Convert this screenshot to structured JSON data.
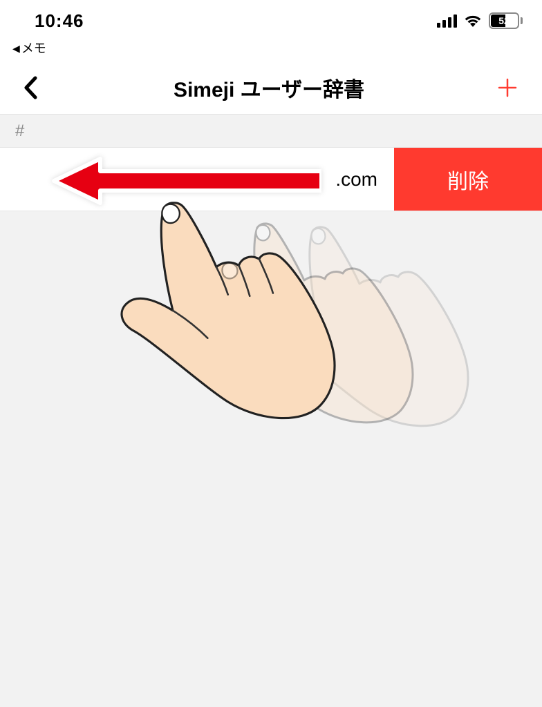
{
  "status": {
    "time": "10:46",
    "battery_percent": "52",
    "back_app_label": "メモ"
  },
  "nav": {
    "title": "Simeji ユーザー辞書"
  },
  "section": {
    "header": "#"
  },
  "row": {
    "visible_text": ".com",
    "delete_label": "削除"
  }
}
